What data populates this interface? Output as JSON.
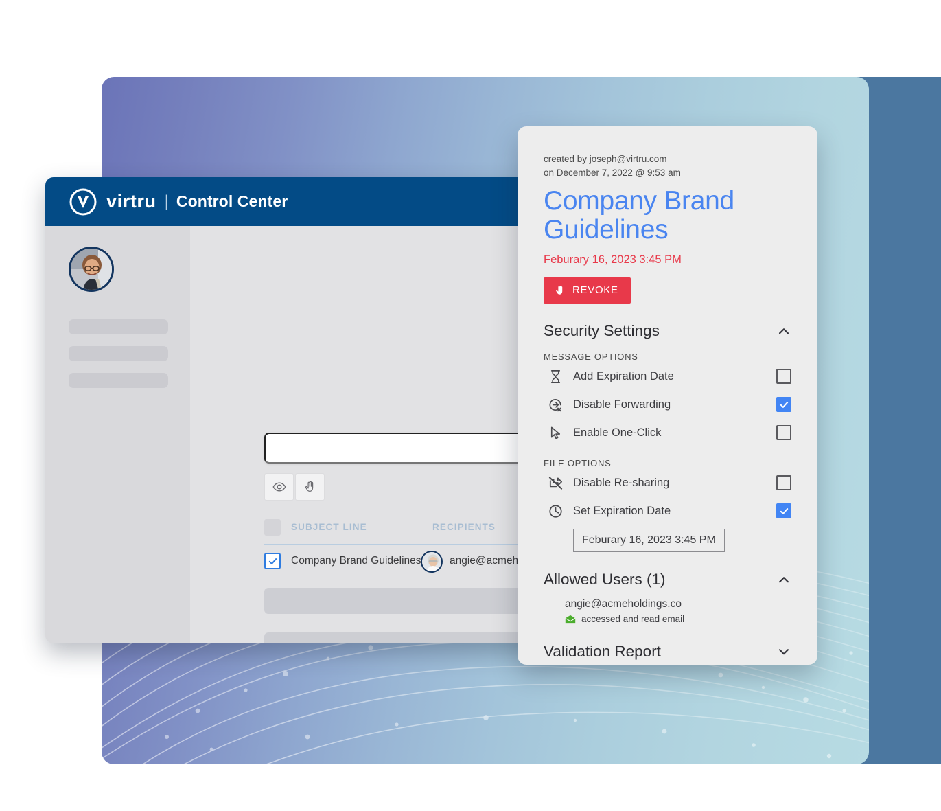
{
  "hero": {
    "gradient_from": "#6b74b8",
    "gradient_to": "#b7dbe3"
  },
  "backing": {
    "color": "#4b77a0"
  },
  "control_center": {
    "navbar": {
      "brand": "virtru",
      "separator": "|",
      "product": "Control Center",
      "background": "#034b86"
    },
    "sidebar": {
      "avatar": "user-photo-avatar",
      "placeholder_count": 3
    },
    "toolbar": {
      "search_value": "",
      "search_placeholder": "",
      "buttons": [
        {
          "name": "preview",
          "icon": "eye-icon"
        },
        {
          "name": "revoke",
          "icon": "hand-icon"
        }
      ]
    },
    "table": {
      "columns": [
        "SUBJECT LINE",
        "RECIPIENTS"
      ],
      "rows": [
        {
          "checked": true,
          "subject": "Company Brand Guidelines",
          "recipient": "angie@acmeholdings.co"
        }
      ],
      "skeleton_rows": 5
    }
  },
  "detail": {
    "created_by": "created by joseph@virtru.com",
    "created_on": "on December 7, 2022 @ 9:53 am",
    "title": "Company Brand Guidelines",
    "expiry": "Feburary 16, 2023 3:45 PM",
    "revoke_label": "REVOKE",
    "revoke_color": "#e8394a",
    "accent_color": "#4a85f0",
    "sections": {
      "security": {
        "title": "Security Settings",
        "expanded": true,
        "message_options_label": "MESSAGE OPTIONS",
        "message_options": [
          {
            "label": "Add Expiration Date",
            "icon": "hourglass-icon",
            "checked": false
          },
          {
            "label": "Disable Forwarding",
            "icon": "forward-disabled-icon",
            "checked": true
          },
          {
            "label": "Enable One-Click",
            "icon": "cursor-icon",
            "checked": false
          }
        ],
        "file_options_label": "FILE OPTIONS",
        "file_options": [
          {
            "label": "Disable Re-sharing",
            "icon": "share-off-icon",
            "checked": false
          },
          {
            "label": "Set Expiration Date",
            "icon": "clock-icon",
            "checked": true
          }
        ],
        "expiration_value": "Feburary 16, 2023 3:45 PM"
      },
      "allowed_users": {
        "title": "Allowed Users (1)",
        "expanded": true,
        "users": [
          {
            "email": "angie@acmeholdings.co",
            "status": "accessed and read email",
            "status_icon": "envelope-open-icon",
            "status_color": "#4cad2e"
          }
        ]
      },
      "validation": {
        "title": "Validation Report",
        "expanded": false
      }
    }
  }
}
